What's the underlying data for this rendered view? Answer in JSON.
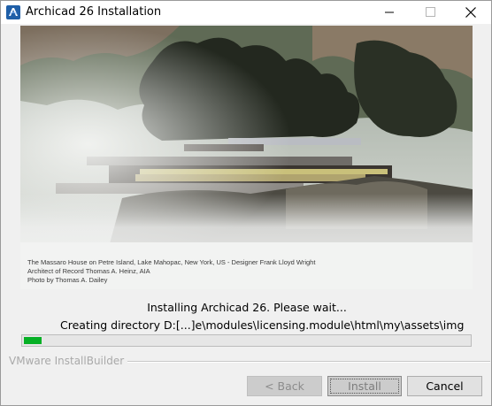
{
  "window": {
    "title": "Archicad 26 Installation"
  },
  "banner": {
    "caption_lines": [
      "The Massaro House on Petre Island, Lake Mahopac, New York, US - Designer Frank Lloyd Wright",
      "Architect of Record Thomas A. Heinz, AIA",
      "Photo by Thomas A. Dailey"
    ]
  },
  "status": {
    "main": "Installing Archicad 26. Please wait...",
    "detail": "Creating directory D:[...]e\\modules\\licensing.module\\html\\my\\assets\\img"
  },
  "progress": {
    "fraction": 0.04,
    "color": "#06b025"
  },
  "brand": {
    "label": "VMware InstallBuilder"
  },
  "buttons": {
    "back": "< Back",
    "install": "Install",
    "cancel": "Cancel"
  },
  "icons": {
    "app": "archicad-logo-icon",
    "minimize": "minimize-icon",
    "maximize": "maximize-icon",
    "close": "close-icon"
  }
}
